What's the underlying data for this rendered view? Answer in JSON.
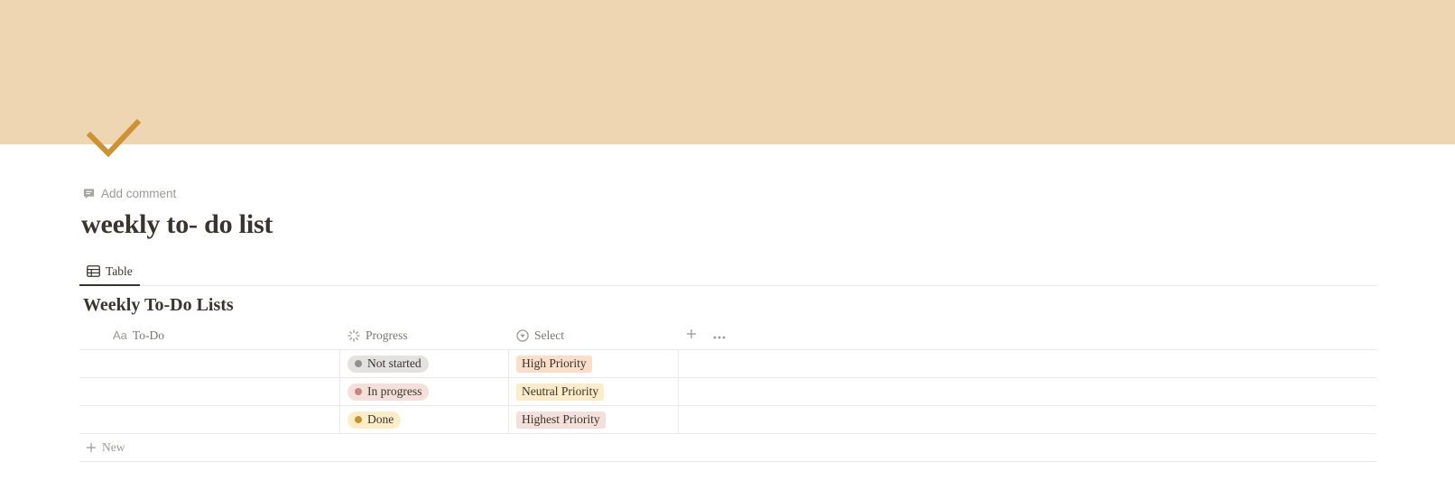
{
  "page": {
    "add_comment_label": "Add comment",
    "title": "weekly to- do list"
  },
  "icons": {
    "page_icon": "checkmark-icon",
    "comment": "comment-icon",
    "table_view": "table-icon",
    "title_property": "text-icon",
    "status_property": "status-icon",
    "select_property": "select-icon",
    "add": "plus-icon",
    "more": "more-icon"
  },
  "colors": {
    "cover": "#eed6b2",
    "checkmark": "#cd9234"
  },
  "views": [
    {
      "label": "Table",
      "active": true
    }
  ],
  "database": {
    "title": "Weekly To-Do Lists",
    "columns": {
      "todo": {
        "icon_text": "Aa",
        "label": "To-Do"
      },
      "progress": {
        "label": "Progress"
      },
      "select": {
        "label": "Select"
      }
    },
    "rows": [
      {
        "todo": "",
        "progress": {
          "label": "Not started",
          "bg": "#e3e2e0",
          "dot": "#91918e"
        },
        "select": {
          "label": "High Priority",
          "bg": "#fadec9"
        }
      },
      {
        "todo": "",
        "progress": {
          "label": "In progress",
          "bg": "#f4dfdb",
          "dot": "#c4877a"
        },
        "select": {
          "label": "Neutral Priority",
          "bg": "#fdecc8"
        }
      },
      {
        "todo": "",
        "progress": {
          "label": "Done",
          "bg": "#fdecc8",
          "dot": "#cb912f"
        },
        "select": {
          "label": "Highest Priority",
          "bg": "#f4dfdb"
        }
      }
    ],
    "new_label": "New"
  }
}
